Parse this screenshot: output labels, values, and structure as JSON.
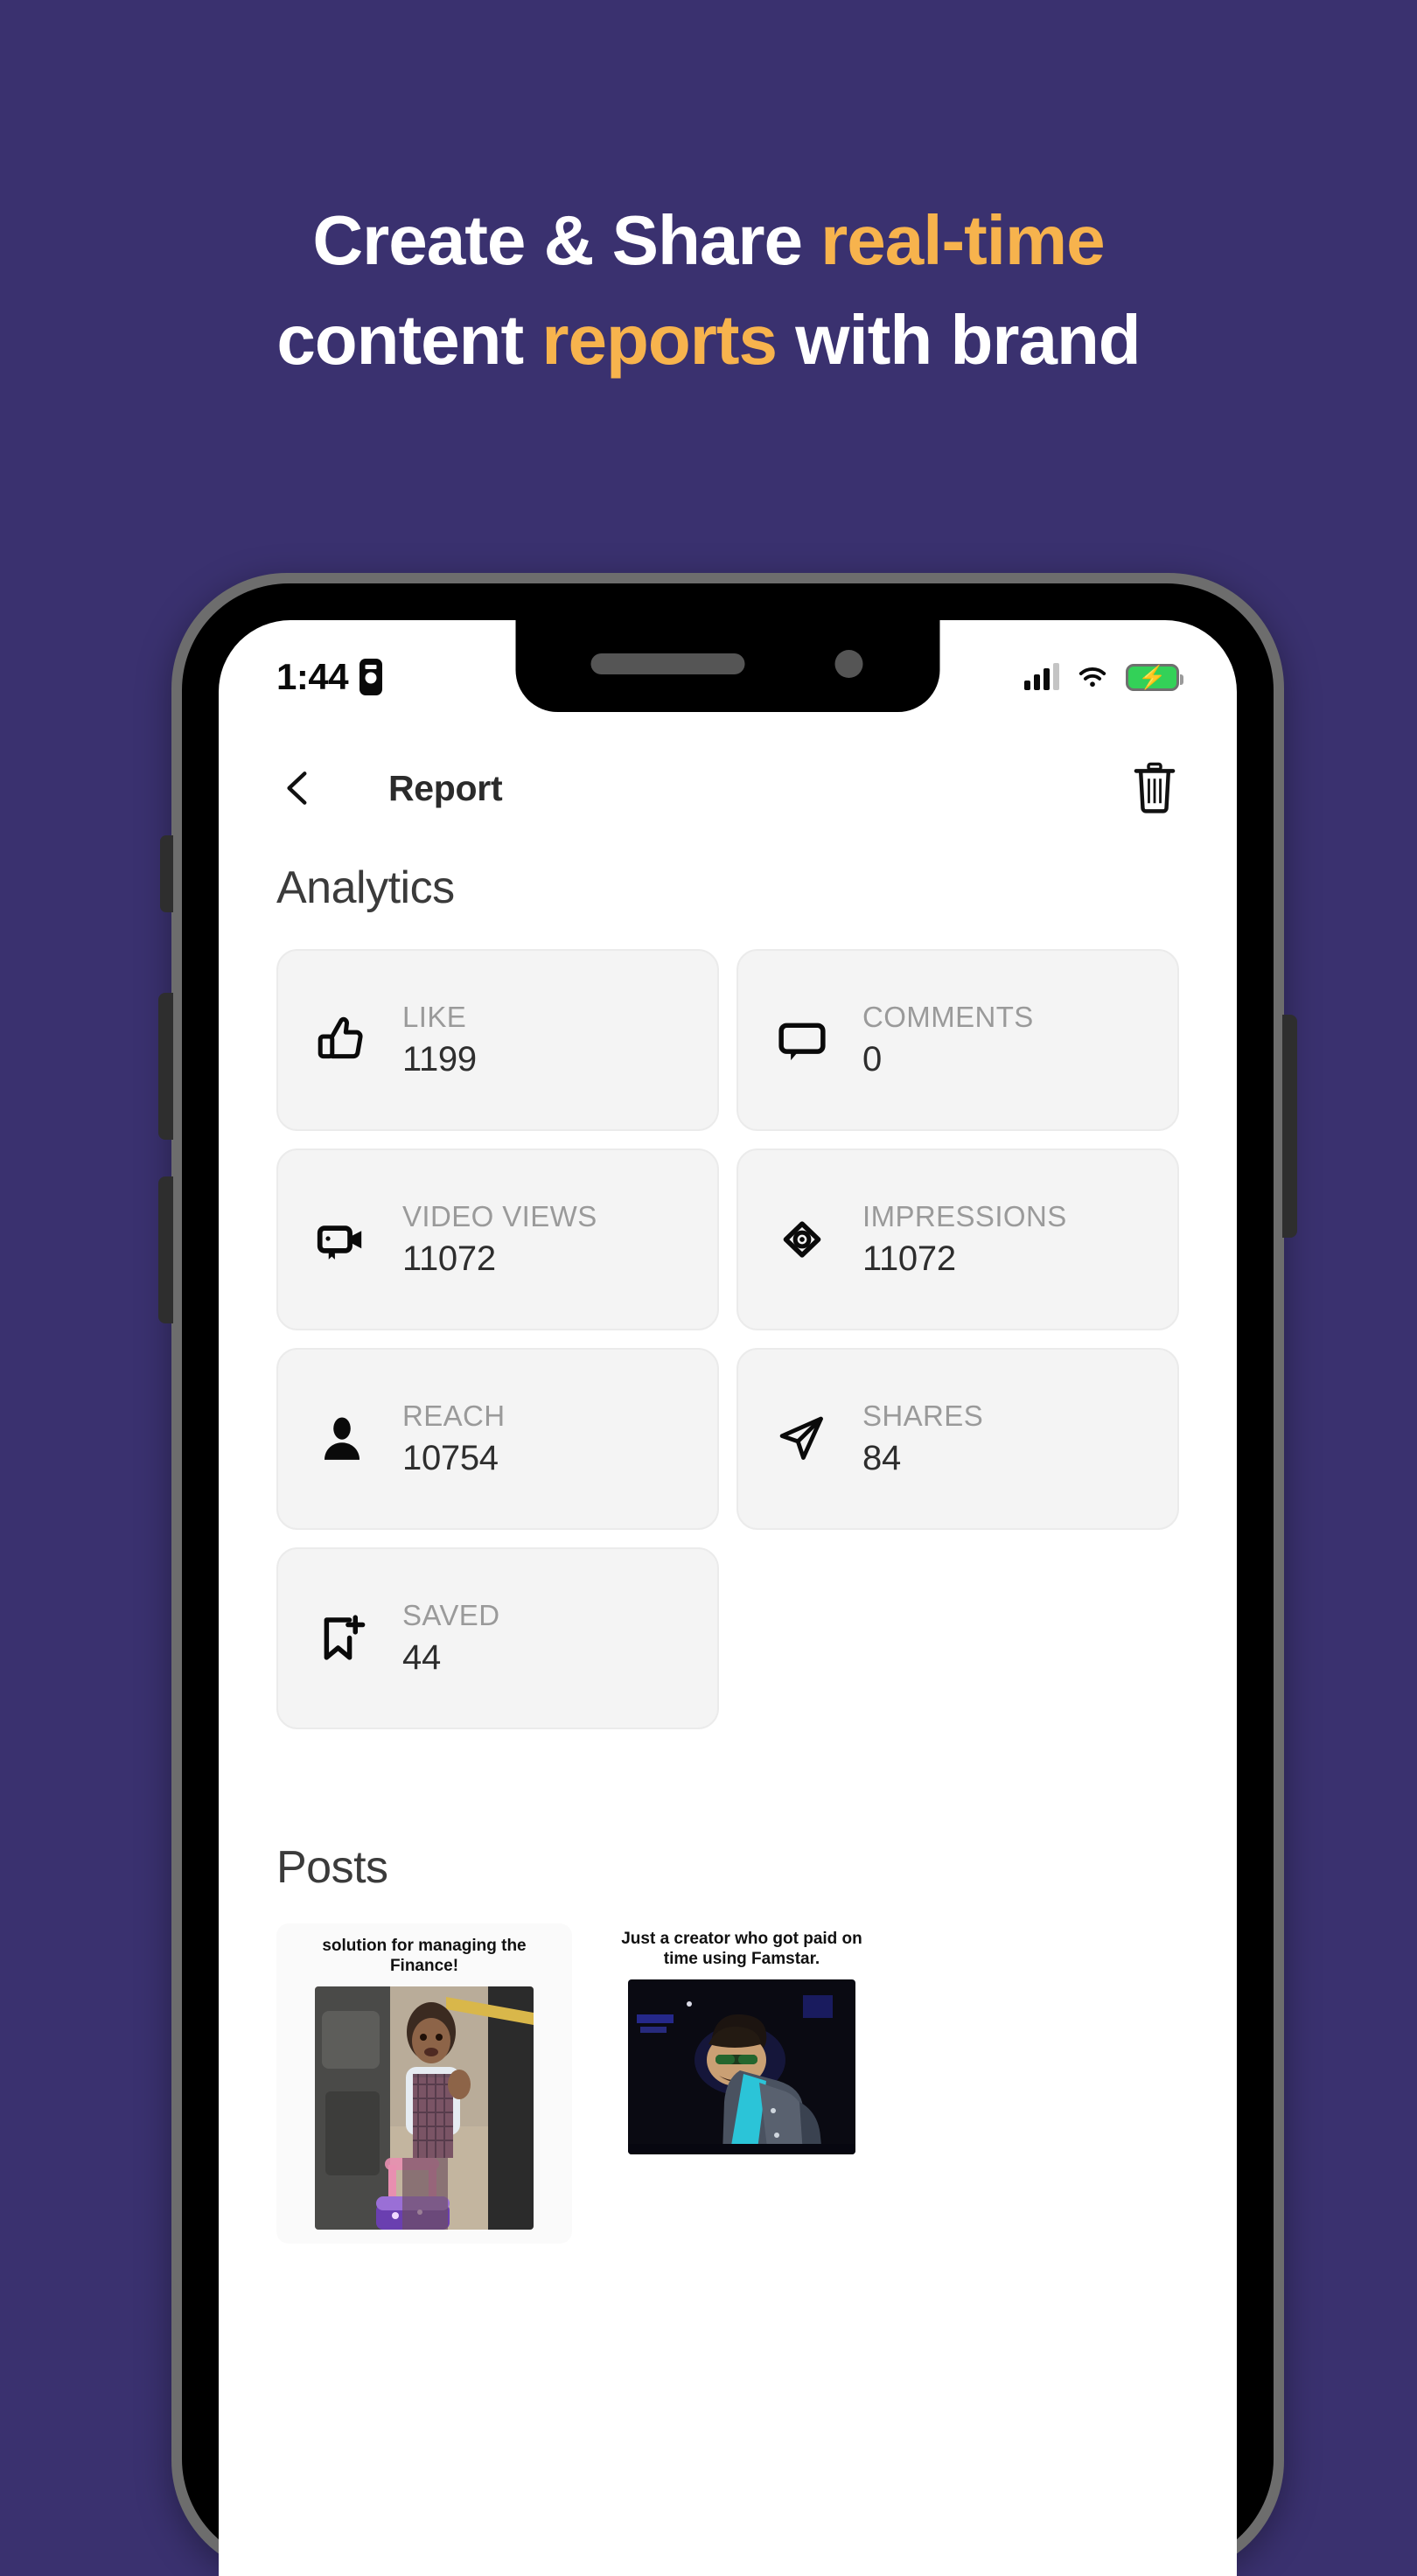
{
  "promo": {
    "line1_white_a": "Create & Share ",
    "line1_accent": "real-time",
    "line2_white_a": "content ",
    "line2_accent": "reports",
    "line2_white_b": " with brand",
    "bg_color": "#3a316f",
    "accent_color": "#f7b34d",
    "text_color": "#ffffff"
  },
  "status_bar": {
    "time": "1:44",
    "recording_icon": "screen-record-icon",
    "signal_icon": "cellular-signal-icon",
    "wifi_icon": "wifi-icon",
    "battery_icon": "battery-charging-icon",
    "battery_color": "#33d158",
    "charging_glyph": "⚡"
  },
  "app_header": {
    "back_icon": "chevron-left-icon",
    "title": "Report",
    "delete_icon": "trash-icon"
  },
  "analytics": {
    "title": "Analytics",
    "cards": [
      {
        "icon": "thumbs-up-icon",
        "label": "LIKE",
        "value": "1199"
      },
      {
        "icon": "comment-icon",
        "label": "COMMENTS",
        "value": "0"
      },
      {
        "icon": "video-camera-icon",
        "label": "VIDEO VIEWS",
        "value": "11072"
      },
      {
        "icon": "eye-icon",
        "label": "IMPRESSIONS",
        "value": "11072"
      },
      {
        "icon": "person-icon",
        "label": "REACH",
        "value": "10754"
      },
      {
        "icon": "send-icon",
        "label": "SHARES",
        "value": "84"
      },
      {
        "icon": "bookmark-plus-icon",
        "label": "SAVED",
        "value": "44"
      }
    ]
  },
  "posts": {
    "title": "Posts",
    "items": [
      {
        "caption": "solution for managing the Finance!"
      },
      {
        "caption": "Just a creator who got paid on time using Famstar."
      }
    ]
  }
}
